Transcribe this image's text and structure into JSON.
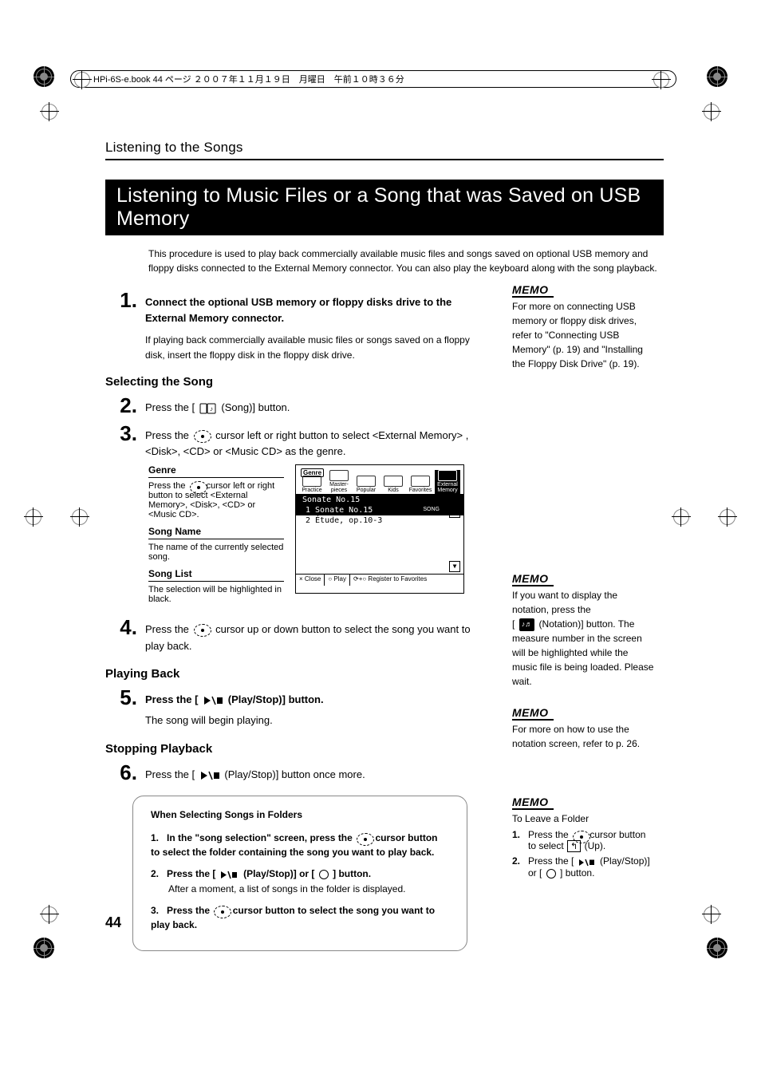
{
  "header": {
    "text": "HPi-6S-e.book  44 ページ  ２００７年１１月１９日　月曜日　午前１０時３６分"
  },
  "running_head": "Listening to the Songs",
  "title": "Listening to Music Files or a Song that was Saved on USB Memory",
  "intro": "This procedure is used to play back commercially available music files and songs saved on optional USB memory and floppy disks connected to the External Memory connector. You can also play the keyboard along with the song playback.",
  "steps": {
    "s1_bold": "Connect the optional USB memory or floppy disks drive to the External Memory connector.",
    "s1_body": "If playing back commercially available music files or songs saved on a floppy disk, insert the floppy disk in the floppy disk drive.",
    "sub_select": "Selecting the Song",
    "s2_a": "Press the [",
    "s2_b": " (Song)] button.",
    "s3_a": "Press the ",
    "s3_b": " cursor left or right button to select <External Memory> , <Disk>, <CD> or <Music CD> as the genre.",
    "s4_a": "Press the ",
    "s4_b": " cursor up or down button to select the song you want to play back.",
    "sub_play": "Playing Back",
    "s5_a": "Press the [",
    "s5_b": " (Play/Stop)] button.",
    "s5_body": "The song will begin playing.",
    "sub_stop": "Stopping Playback",
    "s6_a": "Press the [",
    "s6_b": " (Play/Stop)] button once more."
  },
  "defs": {
    "genre_h": "Genre",
    "genre_a": "Press the ",
    "genre_b": " cursor left or right button to select <External Memory>, <Disk>, <CD> or <Music CD>.",
    "name_h": "Song Name",
    "name_t": "The name of the currently selected song.",
    "list_h": "Song List",
    "list_t": "The selection will be highlighted in black."
  },
  "screen": {
    "genre_lbl": "Genre",
    "tabs": [
      "Practice",
      "Master-pieces",
      "Popular",
      "Kids",
      "Favorites",
      "External Memory"
    ],
    "selected_song": "Sonate No.15",
    "list": [
      {
        "text": "1 Sonate No.15",
        "sel": true
      },
      {
        "text": "2 Étude, op.10-3",
        "sel": false
      }
    ],
    "song_badge": "SONG",
    "foot_close": "× Close",
    "foot_play": "○ Play",
    "foot_reg": "⟳+○ Register to Favorites"
  },
  "memo": {
    "label": "MEMO",
    "m1": "For more on connecting USB memory or floppy disk drives, refer to \"Connecting USB Memory\" (p. 19) and \"Installing the Floppy Disk Drive\" (p. 19).",
    "m2_a": "If you want to display the notation, press the",
    "m2_b": "[",
    "m2_c": " (Notation)] button. The measure number in the screen will be highlighted while the music file is being loaded. Please wait.",
    "m3": "For more on how to use the notation screen, refer to p. 26.",
    "m4_title": "To Leave a Folder",
    "m4_s1_a": "Press the ",
    "m4_s1_b": " cursor button to select ",
    "m4_s1_c": " (Up).",
    "m4_s2_a": "Press the [",
    "m4_s2_b": " (Play/Stop)] or [",
    "m4_s2_c": "] button."
  },
  "folder_box": {
    "title": "When Selecting Songs in Folders",
    "s1_a": "In the \"song selection\" screen, press the ",
    "s1_b": " cursor button to select the folder containing the song you want to play back.",
    "s2_a": "Press the [",
    "s2_b": " (Play/Stop)] or [",
    "s2_c": "] button.",
    "s2_body": "After a moment, a list of songs in the folder is displayed.",
    "s3_a": "Press the ",
    "s3_b": " cursor button to select the song you want to play back."
  },
  "page_number": "44",
  "icons": {
    "up_glyph": "↰",
    "notation_glyph": "♪♬"
  }
}
